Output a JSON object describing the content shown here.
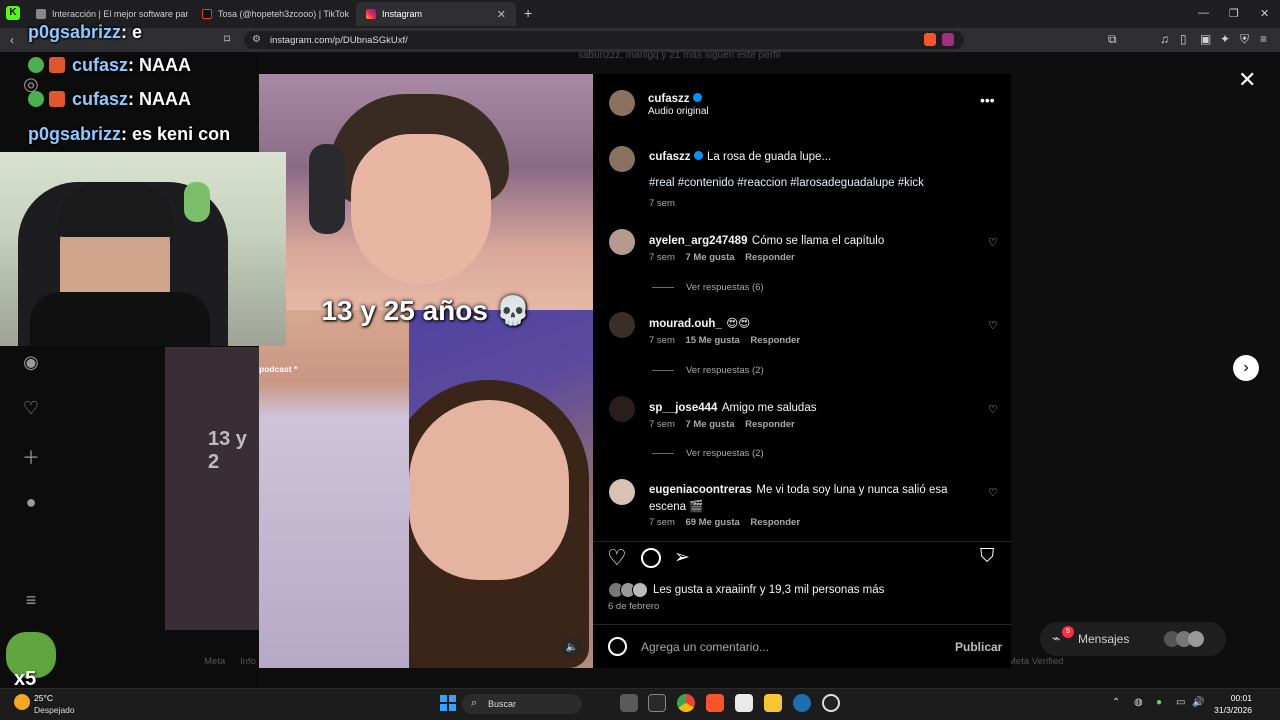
{
  "browser": {
    "tabs": [
      {
        "label": "Interacción | El mejor software para :",
        "active": false
      },
      {
        "label": "Tosa (@hopeteh3zcooo) | TikTok",
        "active": false
      },
      {
        "label": "Instagram",
        "active": true
      }
    ],
    "new_tab": "+",
    "url": "instagram.com/p/DUbnaSGkUxf/"
  },
  "background_hint": "sabunzzz, marilgq y 21 más siguen este perfil",
  "post": {
    "author": "cufaszz",
    "audio": "Audio original",
    "video_caption": "13 y 25 años 💀",
    "caption": {
      "user": "cufaszz",
      "text": "La rosa de guada lupe...",
      "hashtags": "#real #contenido #reaccion #larosadeguadalupe #kick",
      "time": "7 sem"
    },
    "comments": [
      {
        "user": "ayelen_arg247489",
        "text": "Cómo se llama el capítulo",
        "time": "7 sem",
        "likes": "7 Me gusta",
        "reply": "Responder",
        "replies": "Ver respuestas (6)"
      },
      {
        "user": "mourad.ouh_",
        "text": "😍😍",
        "time": "7 sem",
        "likes": "15 Me gusta",
        "reply": "Responder",
        "replies": "Ver respuestas (2)"
      },
      {
        "user": "sp__jose444",
        "text": "Amigo me saludas",
        "time": "7 sem",
        "likes": "7 Me gusta",
        "reply": "Responder",
        "replies": "Ver respuestas (2)"
      },
      {
        "user": "eugeniacoontreras",
        "text": "Me vi toda soy luna y nunca salió esa escena 🎬",
        "time": "7 sem",
        "likes": "69 Me gusta",
        "reply": "Responder"
      }
    ],
    "likes_line": "Les gusta a xraaiinfr y 19,3 mil personas más",
    "date": "6 de febrero",
    "comment_placeholder": "Agrega un comentario...",
    "publish": "Publicar"
  },
  "background_video_fragments": {
    "podcast": "podcast *",
    "caption_fragment": "13 y 2"
  },
  "chat": [
    {
      "user": "p0gsabrizz",
      "text": ": e"
    },
    {
      "user": "cufasz",
      "text": ": NAAA"
    },
    {
      "user": "cufasz",
      "text": ": NAAA"
    },
    {
      "user": "p0gsabrizz",
      "text": ": es keni con"
    }
  ],
  "overlay_counter": "x5",
  "messages": {
    "label": "Mensajes",
    "badge": "5"
  },
  "footer_fragments": {
    "meta": "Meta",
    "info": "Info",
    "meta_verified": "Meta Verified"
  },
  "taskbar": {
    "weather_temp": "25°C",
    "weather_desc": "Despejado",
    "search": "Buscar",
    "time": "00:01",
    "date": "31/3/2026"
  },
  "colors": {
    "accent_blue": "#0095f6",
    "hashtag": "#e0f1ff",
    "panel_bg": "#000000"
  }
}
